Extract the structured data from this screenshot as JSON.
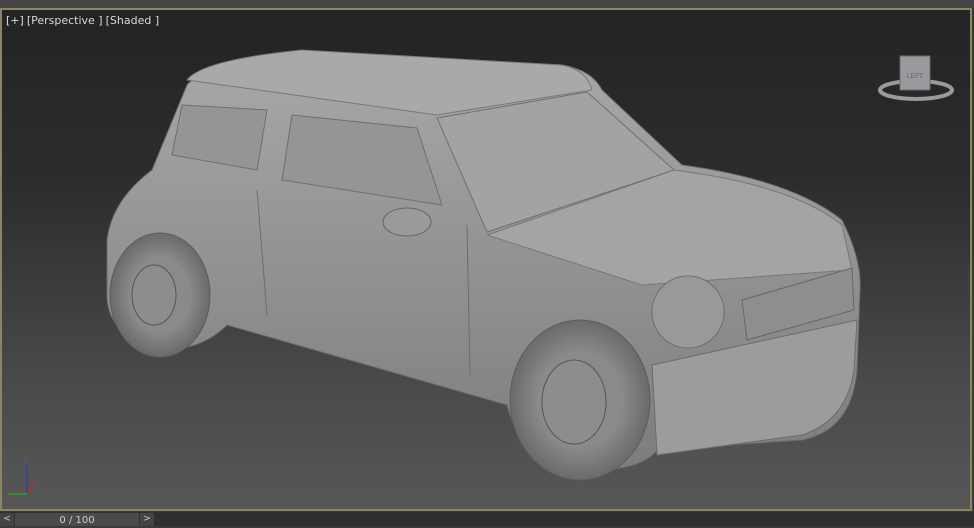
{
  "viewport": {
    "labels": [
      "[+]",
      "[Perspective ]",
      "[Shaded ]"
    ],
    "border_color": "#8c8462",
    "viewcube_face": "LEFT",
    "axes": {
      "z": "z",
      "x": "x",
      "y": "y"
    }
  },
  "timeline": {
    "frame": "0 / 100",
    "prev": "<",
    "next": ">"
  }
}
